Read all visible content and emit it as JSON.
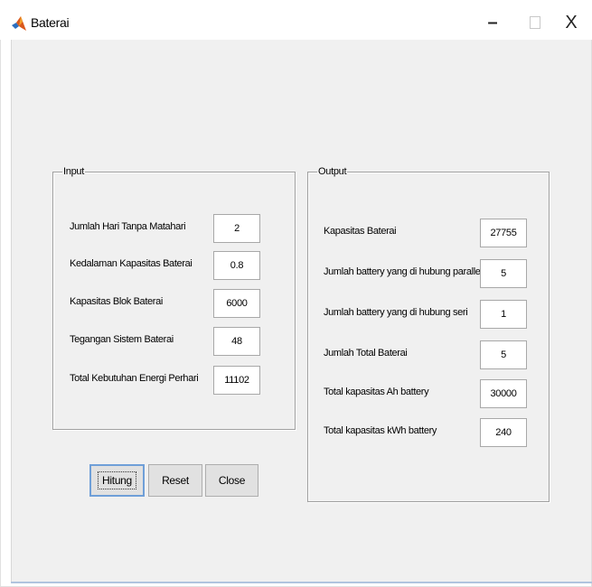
{
  "window": {
    "title": "Baterai",
    "minimize_label": "–",
    "close_label": "X"
  },
  "input_panel": {
    "legend": "Input",
    "rows": [
      {
        "label": "Jumlah Hari Tanpa Matahari",
        "value": "2"
      },
      {
        "label": "Kedalaman Kapasitas Baterai",
        "value": "0.8"
      },
      {
        "label": "Kapasitas Blok Baterai",
        "value": "6000"
      },
      {
        "label": "Tegangan Sistem Baterai",
        "value": "48"
      },
      {
        "label": "Total Kebutuhan Energi Perhari",
        "value": "11102"
      }
    ]
  },
  "output_panel": {
    "legend": "Output",
    "rows": [
      {
        "label": "Kapasitas Baterai",
        "value": "27755"
      },
      {
        "label": "Jumlah battery yang di hubung parallel",
        "value": "5"
      },
      {
        "label": "Jumlah battery yang di hubung seri",
        "value": "1"
      },
      {
        "label": "Jumlah Total Baterai",
        "value": "5"
      },
      {
        "label": "Total kapasitas Ah battery",
        "value": "30000"
      },
      {
        "label": "Total kapasitas kWh battery",
        "value": "240"
      }
    ]
  },
  "buttons": {
    "hitung": "Hitung",
    "reset": "Reset",
    "close": "Close"
  },
  "icons": {
    "app": "matlab-icon",
    "minimize": "minimize-icon",
    "maximize": "maximize-icon",
    "close": "close-icon"
  },
  "colors": {
    "client_background": "#f0f0f0",
    "default_button_border": "#6f9fd8"
  }
}
